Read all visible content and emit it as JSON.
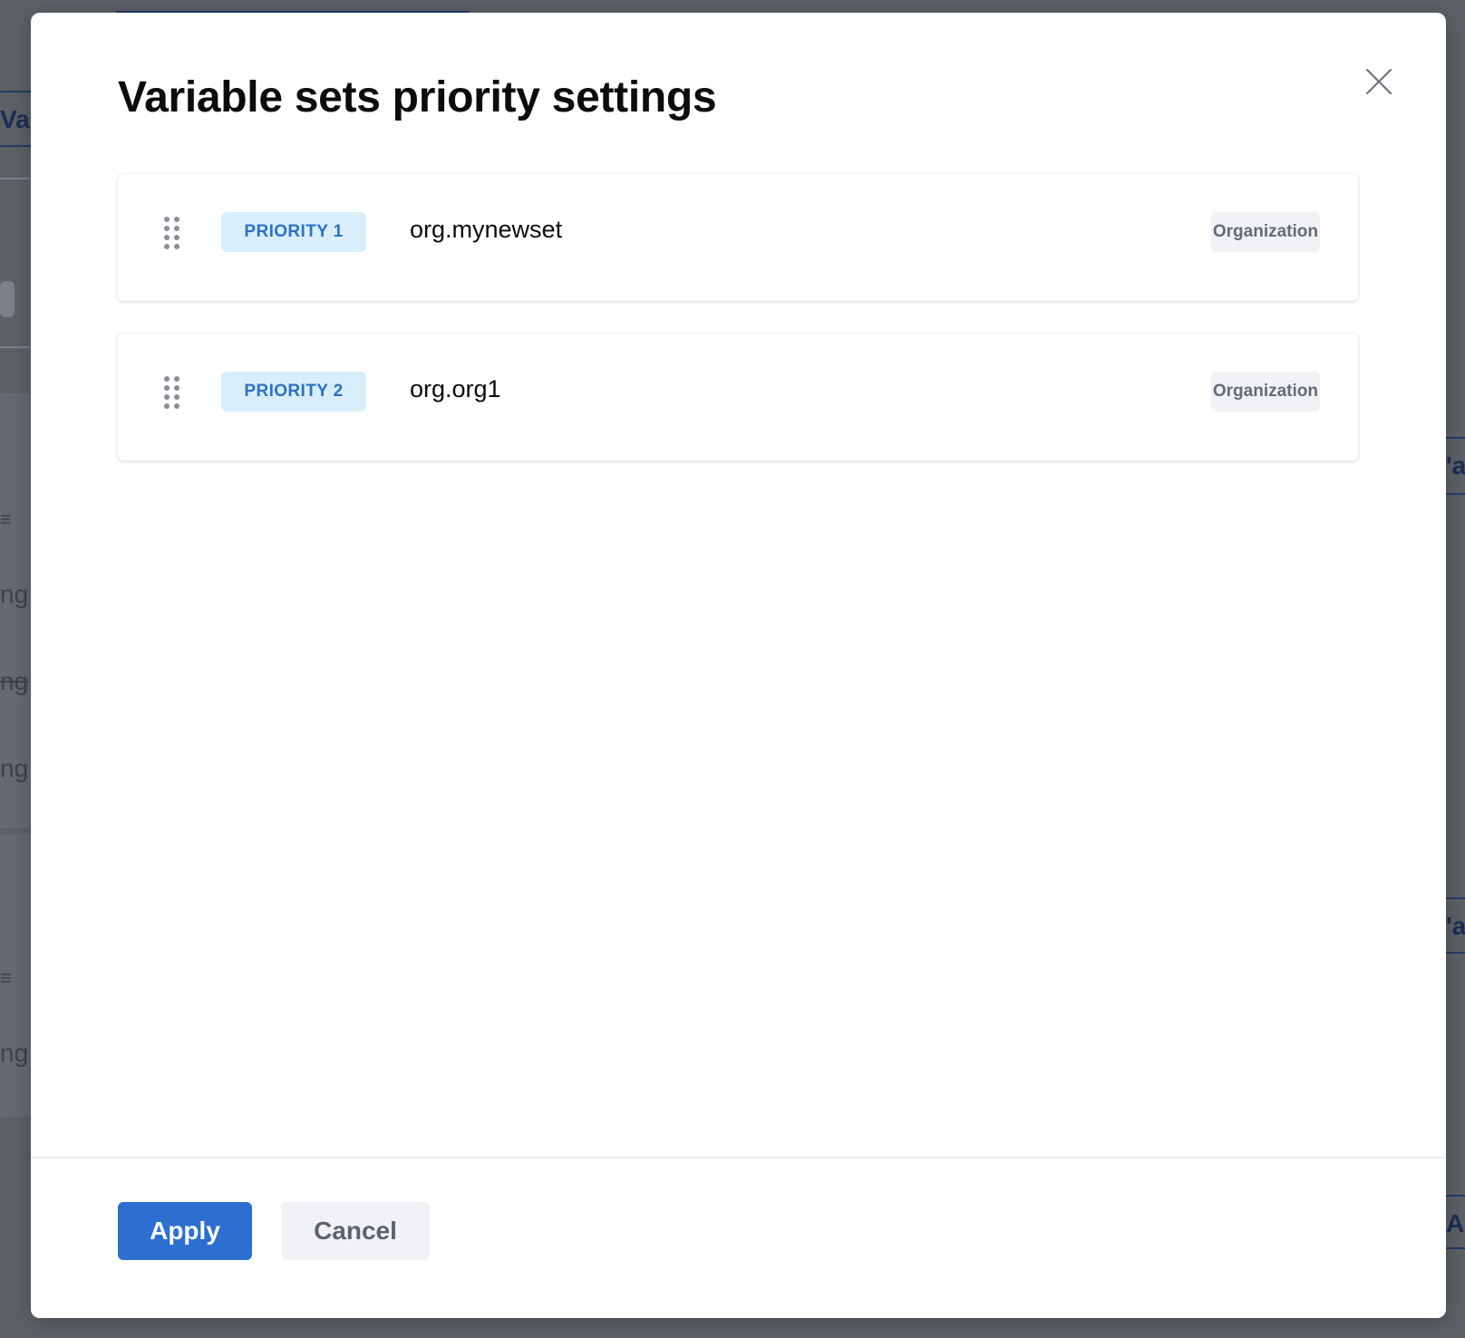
{
  "modal": {
    "title": "Variable sets priority settings",
    "close_icon": "close-icon"
  },
  "items": [
    {
      "priority_label": "PRIORITY 1",
      "name": "org.mynewset",
      "scope": "Organization"
    },
    {
      "priority_label": "PRIORITY 2",
      "name": "org.org1",
      "scope": "Organization"
    }
  ],
  "footer": {
    "apply_label": "Apply",
    "cancel_label": "Cancel"
  },
  "background": {
    "left_tab_text": "Va",
    "left_fragments": [
      "ng",
      "ng",
      "ng",
      "ng"
    ],
    "right_tab_text_1": "'a",
    "right_tab_text_2": "'a",
    "right_tab_text_3": "Ad"
  },
  "colors": {
    "accent": "#2c6fd1",
    "priority_badge_bg": "#d8effb",
    "priority_badge_text": "#2e70c4",
    "scope_badge_bg": "#f1f2f5",
    "overlay": "#5c6166"
  }
}
